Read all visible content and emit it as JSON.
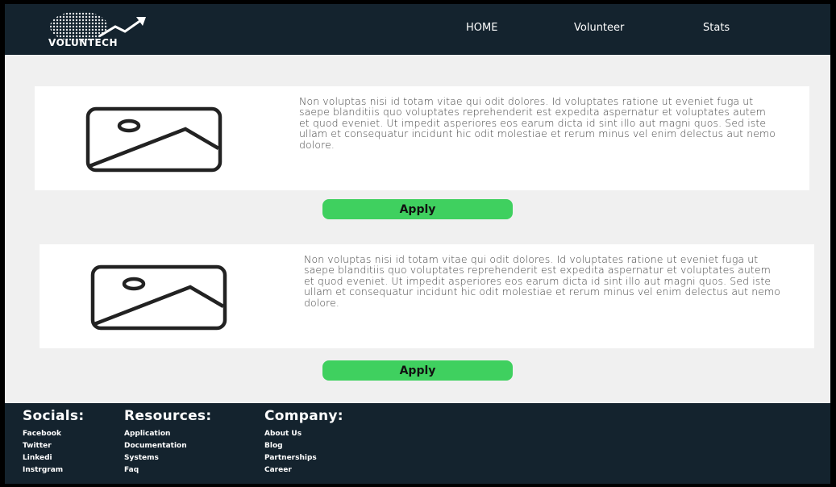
{
  "brand": {
    "name": "VOLUNTECH"
  },
  "nav": {
    "items": [
      "HOME",
      "Volunteer",
      "Stats"
    ]
  },
  "cards": [
    {
      "text": "Non voluptas nisi id totam vitae qui odit dolores. Id voluptates ratione ut eveniet fuga ut saepe blanditiis quo voluptates reprehenderit est  expedita aspernatur et voluptates autem et quod eveniet. Ut impedit  asperiores eos earum dicta id sint illo aut magni quos. Sed iste ullam  et consequatur incidunt hic odit molestiae et rerum  minus vel enim delectus aut nemo dolore.",
      "button": "Apply"
    },
    {
      "text": "Non voluptas nisi id totam vitae qui odit dolores. Id voluptates ratione ut eveniet fuga ut saepe blanditiis quo voluptates reprehenderit est  expedita aspernatur et voluptates autem et quod eveniet. Ut impedit  asperiores eos earum dicta id sint illo aut magni quos. Sed iste ullam  et consequatur incidunt hic odit molestiae et rerum  minus vel enim delectus aut nemo dolore.",
      "button": "Apply"
    }
  ],
  "footer": {
    "socials": {
      "title": "Socials:",
      "items": [
        "Facebook",
        "Twitter",
        "Linkedi",
        "Instrgram"
      ]
    },
    "resources": {
      "title": "Resources:",
      "items": [
        "Application",
        "Documentation",
        "Systems",
        "Faq"
      ]
    },
    "company": {
      "title": "Company:",
      "items": [
        "About Us",
        "Blog",
        "Partnerships",
        "Career"
      ]
    }
  },
  "colors": {
    "header_bg": "#14232e",
    "page_bg": "#f0f0f0",
    "button": "#3fd05f"
  }
}
